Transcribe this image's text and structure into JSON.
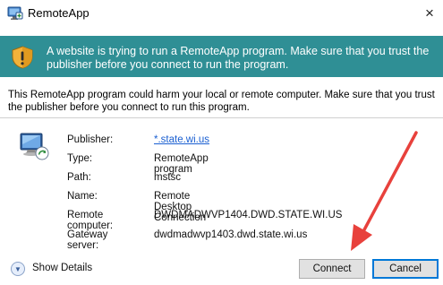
{
  "window": {
    "title": "RemoteApp",
    "close_glyph": "×"
  },
  "banner": {
    "icon": "shield-warning-icon",
    "text": "A website is trying to run a RemoteApp program. Make sure that you trust the publisher before you connect to run the program.",
    "color": "#2f8f95"
  },
  "description": "This RemoteApp program could harm your local or remote computer. Make sure that you trust the publisher before you connect to run this program.",
  "details": {
    "icon": "remote-desktop-icon",
    "rows": [
      {
        "label": "Publisher:",
        "value": "*.state.wi.us"
      },
      {
        "label": "Type:",
        "value": "RemoteApp program"
      },
      {
        "label": "Path:",
        "value": "mstsc"
      },
      {
        "label": "Name:",
        "value": "Remote Desktop Connection"
      },
      {
        "label": "Remote computer:",
        "value": "DWDMADWVP1404.DWD.STATE.WI.US"
      },
      {
        "label": "Gateway server:",
        "value": "dwdmadwvp1403.dwd.state.wi.us"
      }
    ]
  },
  "footer": {
    "show_details": "Show Details",
    "connect": "Connect",
    "cancel": "Cancel"
  },
  "annotation": {
    "color": "#e8413c"
  }
}
